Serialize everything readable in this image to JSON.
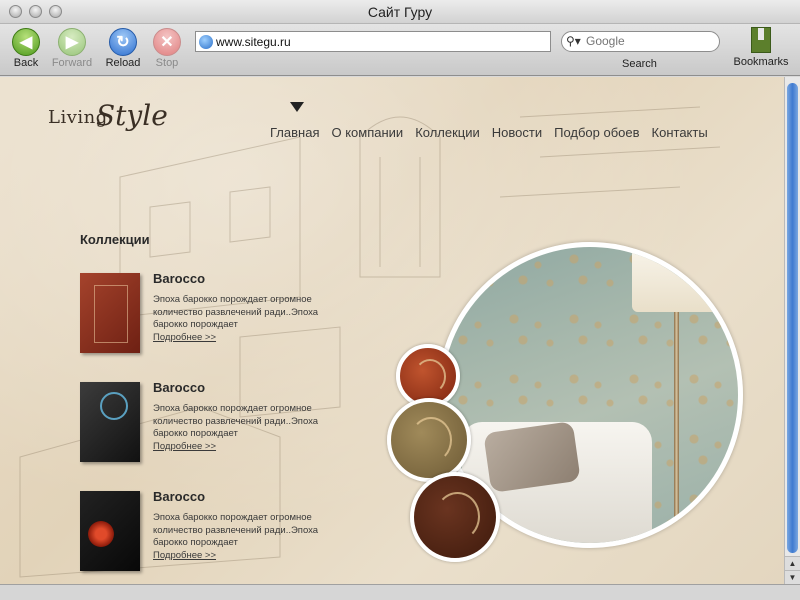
{
  "window": {
    "title": "Сайт Гуру"
  },
  "toolbar": {
    "back_label": "Back",
    "forward_label": "Forward",
    "reload_label": "Reload",
    "stop_label": "Stop",
    "url": "www.sitegu.ru",
    "search_placeholder": "Google",
    "search_label": "Search",
    "bookmarks_label": "Bookmarks",
    "icons": {
      "back": "arrow-left",
      "forward": "arrow-right",
      "reload": "reload",
      "stop": "x"
    }
  },
  "site": {
    "logo": {
      "part1": "Living",
      "part2": "Style"
    },
    "nav": [
      "Главная",
      "О компании",
      "Коллекции",
      "Новости",
      "Подбор обоев",
      "Контакты"
    ],
    "section_title": "Коллекции",
    "collections": [
      {
        "title": "Barocco",
        "desc": "Эпоха барокко порождает огромное количество развлечений ради..Эпоха барокко порождает",
        "more": "Подробнее >>"
      },
      {
        "title": "Barocco",
        "desc": "Эпоха барокко порождает огромное количество развлечений ради..Эпоха барокко порождает",
        "more": "Подробнее >>"
      },
      {
        "title": "Barocco",
        "desc": "Эпоха барокко порождает огромное количество развлечений ради..Эпоха барокко порождает",
        "more": "Подробнее >>"
      }
    ]
  }
}
